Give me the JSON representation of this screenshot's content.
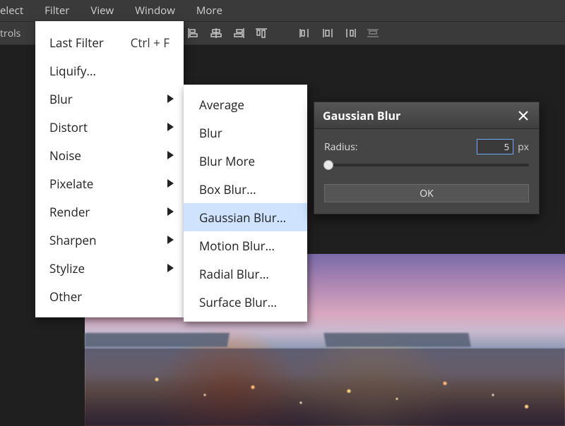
{
  "menubar": {
    "items": [
      {
        "label": "elect"
      },
      {
        "label": "Filter"
      },
      {
        "label": "View"
      },
      {
        "label": "Window"
      },
      {
        "label": "More"
      }
    ]
  },
  "toolbar": {
    "left_label": "trols"
  },
  "filter_menu": {
    "last_filter": {
      "label": "Last Filter",
      "shortcut": "Ctrl + F"
    },
    "liquify": "Liquify...",
    "items": [
      "Blur",
      "Distort",
      "Noise",
      "Pixelate",
      "Render",
      "Sharpen",
      "Stylize",
      "Other"
    ]
  },
  "blur_submenu": {
    "items": [
      "Average",
      "Blur",
      "Blur More",
      "Box Blur...",
      "Gaussian Blur...",
      "Motion Blur...",
      "Radial Blur...",
      "Surface Blur..."
    ],
    "highlighted_index": 4
  },
  "dialog": {
    "title": "Gaussian Blur",
    "radius_label": "Radius:",
    "radius_value": "5",
    "radius_unit": "px",
    "ok_label": "OK"
  }
}
